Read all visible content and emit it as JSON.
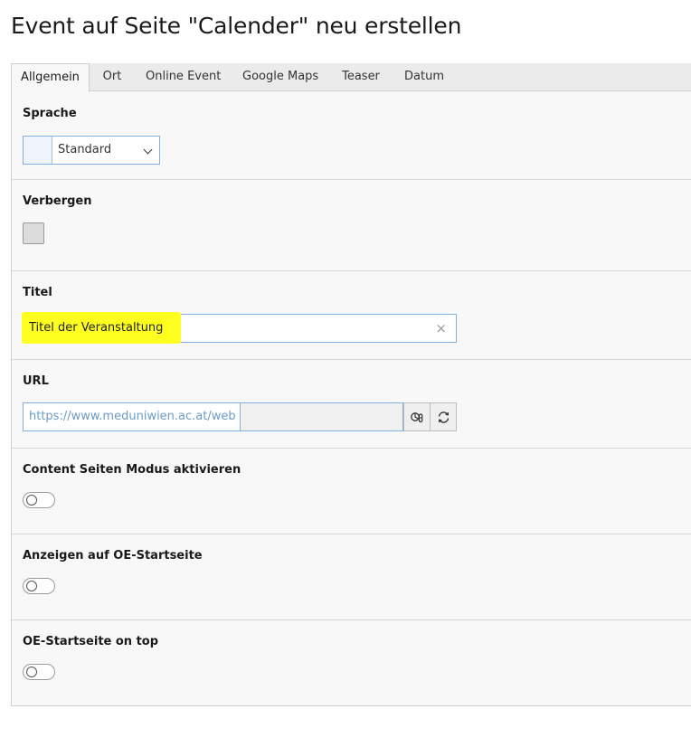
{
  "page": {
    "title": "Event auf Seite \"Calender\" neu erstellen"
  },
  "tabs": [
    {
      "label": "Allgemein",
      "active": true
    },
    {
      "label": "Ort",
      "active": false
    },
    {
      "label": "Online Event",
      "active": false
    },
    {
      "label": "Google Maps",
      "active": false
    },
    {
      "label": "Teaser",
      "active": false
    },
    {
      "label": "Datum",
      "active": false
    }
  ],
  "fields": {
    "sprache": {
      "label": "Sprache",
      "value": "Standard"
    },
    "verbergen": {
      "label": "Verbergen",
      "checked": false
    },
    "titel": {
      "label": "Titel",
      "value": "Titel der Veranstaltung",
      "highlight_color": "#ffff1f"
    },
    "url": {
      "label": "URL",
      "value": "https://www.meduniwien.ac.at/web"
    },
    "content_seiten_modus": {
      "label": "Content Seiten Modus aktivieren",
      "enabled": false
    },
    "anzeigen_oe_startseite": {
      "label": "Anzeigen auf OE-Startseite",
      "enabled": false
    },
    "oe_startseite_on_top": {
      "label": "OE-Startseite on top",
      "enabled": false
    }
  },
  "icons": {
    "url_button_1": "wizard-icon",
    "url_button_2": "refresh-icon",
    "clear": "close-icon"
  },
  "colors": {
    "accent_border": "#7fb0df",
    "panel_bg": "#f8f8f8"
  }
}
